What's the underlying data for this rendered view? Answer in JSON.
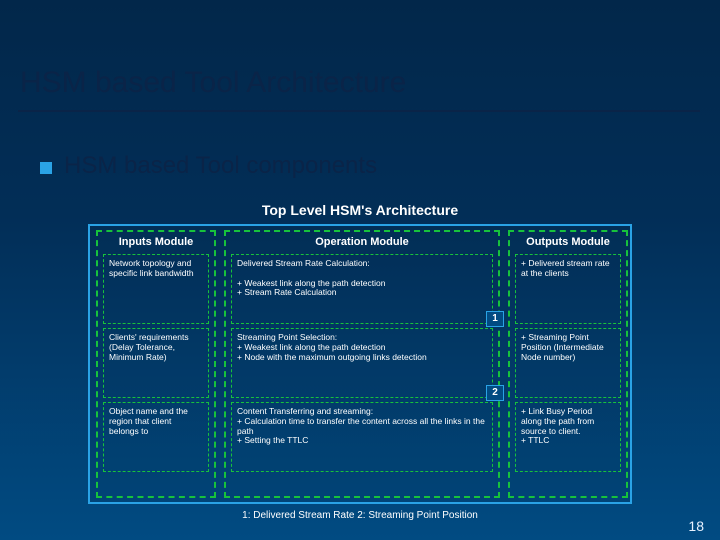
{
  "title": "HSM based Tool Architecture",
  "bullet": "HSM based Tool components",
  "subtitle": "Top Level HSM's Architecture",
  "columns": {
    "inputs": {
      "header": "Inputs Module"
    },
    "op": {
      "header": "Operation Module"
    },
    "outputs": {
      "header": "Outputs Module"
    }
  },
  "rows": [
    {
      "input": "Network topology and specific link bandwidth",
      "op": "Delivered Stream Rate Calculation:\n\n+ Weakest link along the path detection\n+ Stream Rate Calculation",
      "badge": "1",
      "output": "+ Delivered stream rate at the clients"
    },
    {
      "input": "Clients' requirements (Delay Tolerance, Minimum Rate)",
      "op": "Streaming Point Selection:\n+ Weakest link along the path detection\n+ Node with the maximum outgoing links detection",
      "badge": "2",
      "output": "+ Streaming Point  Position (Intermediate Node number)"
    },
    {
      "input": "Object name and the region that client belongs to",
      "op": "Content Transferring and streaming:\n+ Calculation time to transfer the content across all the links in the path\n+ Setting the TTLC",
      "badge": "",
      "output": "+ Link Busy Period along the path from source to client.\n+ TTLC"
    }
  ],
  "legend": "1: Delivered Stream Rate    2: Streaming Point Position",
  "page_number": "18"
}
